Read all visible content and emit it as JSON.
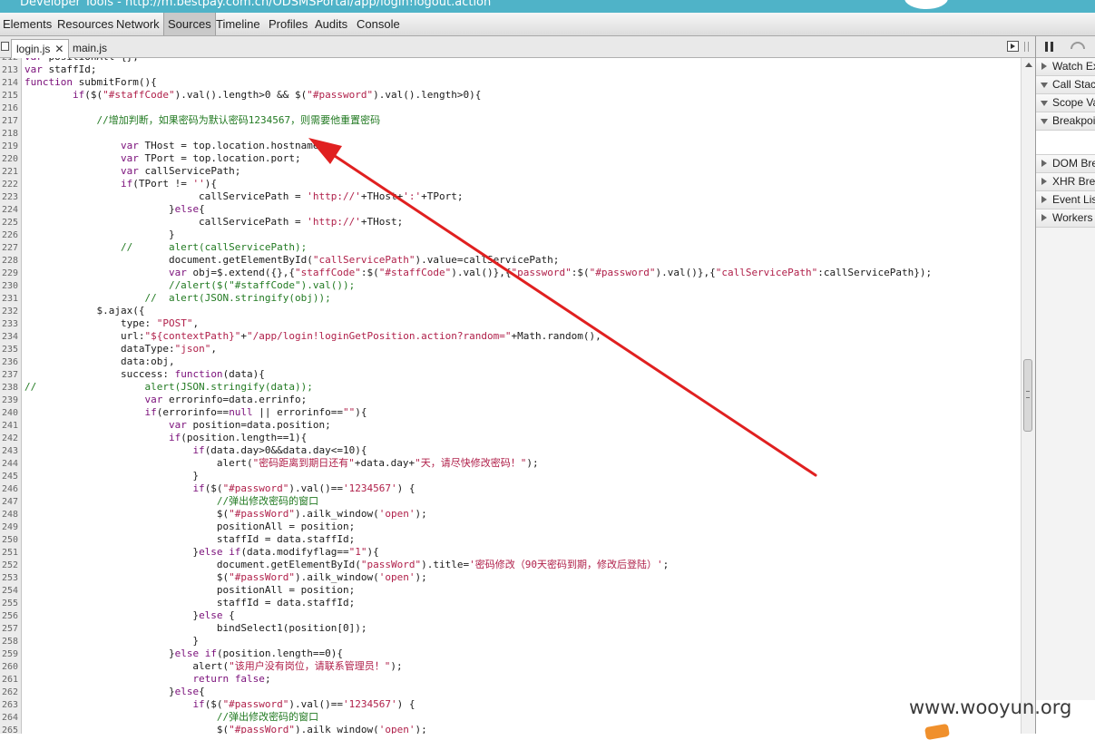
{
  "window": {
    "title": "Developer Tools - http://m.bestpay.com.cn/ODSMSPortal/app/login!logout.action"
  },
  "main_tabs": [
    "Elements",
    "Resources",
    "Network",
    "Sources",
    "Timeline",
    "Profiles",
    "Audits",
    "Console"
  ],
  "active_main_tab": "Sources",
  "file_tabs": [
    {
      "name": "login.js",
      "closable": true,
      "active": true
    },
    {
      "name": "main.js",
      "closable": false,
      "active": false
    }
  ],
  "close_glyph": "✕",
  "sidebar_panes": [
    {
      "label": "Watch Expressions",
      "expanded": false
    },
    {
      "label": "Call Stack",
      "expanded": true
    },
    {
      "label": "Scope Variables",
      "expanded": true
    },
    {
      "label": "Breakpoints",
      "expanded": true
    },
    {
      "label": "DOM Breakpoints",
      "expanded": false
    },
    {
      "label": "XHR Breakpoints",
      "expanded": false
    },
    {
      "label": "Event Listener Breakpoints",
      "expanded": false
    },
    {
      "label": "Workers",
      "expanded": false
    }
  ],
  "code": [
    {
      "n": "212",
      "t": "var positionAll={};"
    },
    {
      "n": "213",
      "t": "var staffId;"
    },
    {
      "n": "214",
      "t": "function submitForm(){"
    },
    {
      "n": "215",
      "t": "        if($(\"#staffCode\").val().length>0 && $(\"#password\").val().length>0){"
    },
    {
      "n": "216",
      "t": ""
    },
    {
      "n": "217",
      "t": "            //增加判断，如果密码为默认密码1234567，则需要他重置密码"
    },
    {
      "n": "218",
      "t": ""
    },
    {
      "n": "219",
      "t": "                var THost = top.location.hostname;"
    },
    {
      "n": "220",
      "t": "                var TPort = top.location.port;"
    },
    {
      "n": "221",
      "t": "                var callServicePath;"
    },
    {
      "n": "222",
      "t": "                if(TPort != ''){"
    },
    {
      "n": "223",
      "t": "                             callServicePath = 'http://'+THost+':'+TPort;"
    },
    {
      "n": "224",
      "t": "                        }else{"
    },
    {
      "n": "225",
      "t": "                             callServicePath = 'http://'+THost;"
    },
    {
      "n": "226",
      "t": "                        }"
    },
    {
      "n": "227",
      "t": "                //      alert(callServicePath);"
    },
    {
      "n": "228",
      "t": "                        document.getElementById(\"callServicePath\").value=callServicePath;"
    },
    {
      "n": "229",
      "t": "                        var obj=$.extend({},{\"staffCode\":$(\"#staffCode\").val()},{\"password\":$(\"#password\").val()},{\"callServicePath\":callServicePath});"
    },
    {
      "n": "230",
      "t": "                        //alert($(\"#staffCode\").val());"
    },
    {
      "n": "231",
      "t": "                    //  alert(JSON.stringify(obj));"
    },
    {
      "n": "232",
      "t": "            $.ajax({"
    },
    {
      "n": "233",
      "t": "                type: \"POST\","
    },
    {
      "n": "234",
      "t": "                url:\"${contextPath}\"+\"/app/login!loginGetPosition.action?random=\"+Math.random(),"
    },
    {
      "n": "235",
      "t": "                dataType:\"json\","
    },
    {
      "n": "236",
      "t": "                data:obj,"
    },
    {
      "n": "237",
      "t": "                success: function(data){"
    },
    {
      "n": "238",
      "t": "//                  alert(JSON.stringify(data));"
    },
    {
      "n": "239",
      "t": "                    var errorinfo=data.errinfo;"
    },
    {
      "n": "240",
      "t": "                    if(errorinfo==null || errorinfo==\"\"){"
    },
    {
      "n": "241",
      "t": "                        var position=data.position;"
    },
    {
      "n": "242",
      "t": "                        if(position.length==1){"
    },
    {
      "n": "243",
      "t": "                            if(data.day>0&&data.day<=10){"
    },
    {
      "n": "244",
      "t": "                                alert(\"密码距离到期日还有\"+data.day+\"天，请尽快修改密码！\");"
    },
    {
      "n": "245",
      "t": "                            }"
    },
    {
      "n": "246",
      "t": "                            if($(\"#password\").val()=='1234567') {"
    },
    {
      "n": "247",
      "t": "                                //弹出修改密码的窗口"
    },
    {
      "n": "248",
      "t": "                                $(\"#passWord\").ailk_window('open');"
    },
    {
      "n": "249",
      "t": "                                positionAll = position;"
    },
    {
      "n": "250",
      "t": "                                staffId = data.staffId;"
    },
    {
      "n": "251",
      "t": "                            }else if(data.modifyflag==\"1\"){"
    },
    {
      "n": "252",
      "t": "                                document.getElementById(\"passWord\").title='密码修改（90天密码到期，修改后登陆）';"
    },
    {
      "n": "253",
      "t": "                                $(\"#passWord\").ailk_window('open');"
    },
    {
      "n": "254",
      "t": "                                positionAll = position;"
    },
    {
      "n": "255",
      "t": "                                staffId = data.staffId;"
    },
    {
      "n": "256",
      "t": "                            }else {"
    },
    {
      "n": "257",
      "t": "                                bindSelect1(position[0]);"
    },
    {
      "n": "258",
      "t": "                            }"
    },
    {
      "n": "259",
      "t": "                        }else if(position.length==0){"
    },
    {
      "n": "260",
      "t": "                            alert(\"该用户没有岗位，请联系管理员！\");"
    },
    {
      "n": "261",
      "t": "                            return false;"
    },
    {
      "n": "262",
      "t": "                        }else{"
    },
    {
      "n": "263",
      "t": "                            if($(\"#password\").val()=='1234567') {"
    },
    {
      "n": "264",
      "t": "                                //弹出修改密码的窗口"
    },
    {
      "n": "265",
      "t": "                                $(\"#passWord\").ailk_window('open');"
    }
  ],
  "annotation": {
    "color": "#e02020"
  },
  "watermark": "www.wooyun.org"
}
